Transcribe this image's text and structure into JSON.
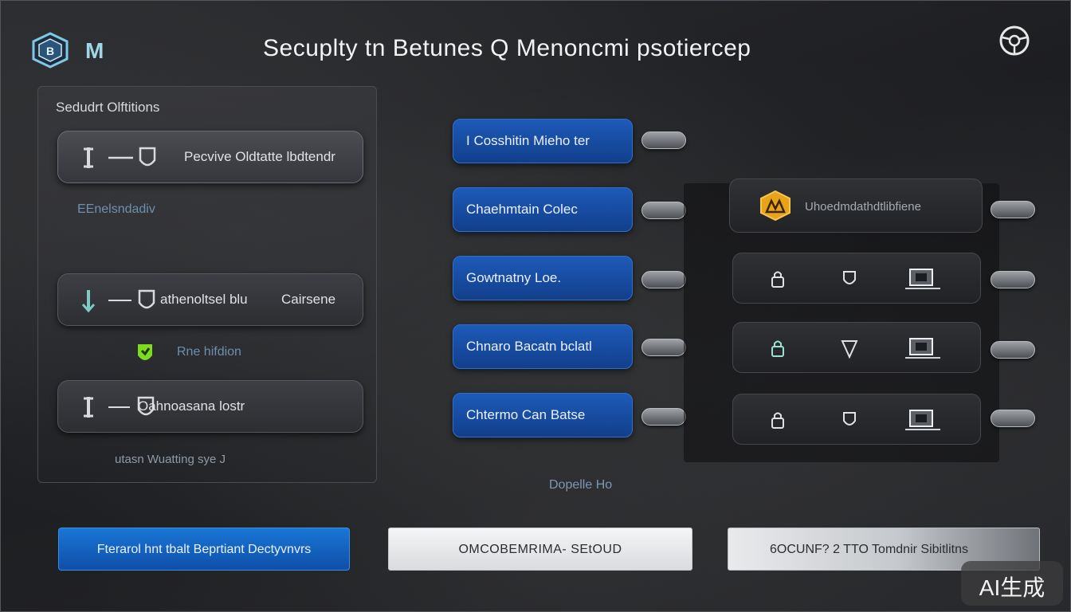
{
  "header": {
    "logo_letter": "M",
    "title": "Secuplty  tn  Betunes  Q  Menoncmi  psotiercep",
    "settings_icon": "steering-wheel-icon"
  },
  "left_panel": {
    "title": "Sedudrt Olftitions",
    "options": [
      {
        "label": "Pecvive  Oldtatte  lbdtendr",
        "icon": "key-shield-icon"
      },
      {
        "label": "athenoltsel  blu",
        "label_right": "Cairsene",
        "icon": "key-shield-icon"
      },
      {
        "label": "Oahnoasana  lostr",
        "icon": "key-shield-icon"
      }
    ],
    "notes": [
      "EEnelsndadiv",
      "Rne  hifdion",
      "utasn  Wuatting  sye  J"
    ]
  },
  "middle": {
    "buttons": [
      "I Cosshitin Mieho ter",
      "Chaehmtain  Colec",
      "Gowtnatny  Loe.",
      "Chnaro  Bacatn  bclatl",
      "Chtermo  Can  Batse"
    ],
    "note": "Dopelle  Ho"
  },
  "right": {
    "header_label": "Uhoedmdathdtlibfiene",
    "header_icon": "warning-shield-icon",
    "rows": [
      {
        "icons": [
          "lock-icon",
          "shield-icon",
          "chip-icon"
        ]
      },
      {
        "icons": [
          "lock-icon",
          "shield-icon",
          "chip-icon"
        ]
      },
      {
        "icons": [
          "lock-icon",
          "shield-icon",
          "chip-icon"
        ]
      }
    ]
  },
  "footer": {
    "primary": "Fterarol  hnt  tbalt  Beprtiant  Dectyvnvrs",
    "secondary": "OMCOBEMRIMA-  SEtOUD",
    "tertiary": "6OCUNF? 2 TTO Tomdnir  Sibitlitns"
  },
  "watermark": "AI生成",
  "colors": {
    "accent_blue": "#1d5ab8",
    "primary_button": "#1a76d6",
    "warning_icon": "#e8a318",
    "lime_icon": "#7ddc1f"
  }
}
